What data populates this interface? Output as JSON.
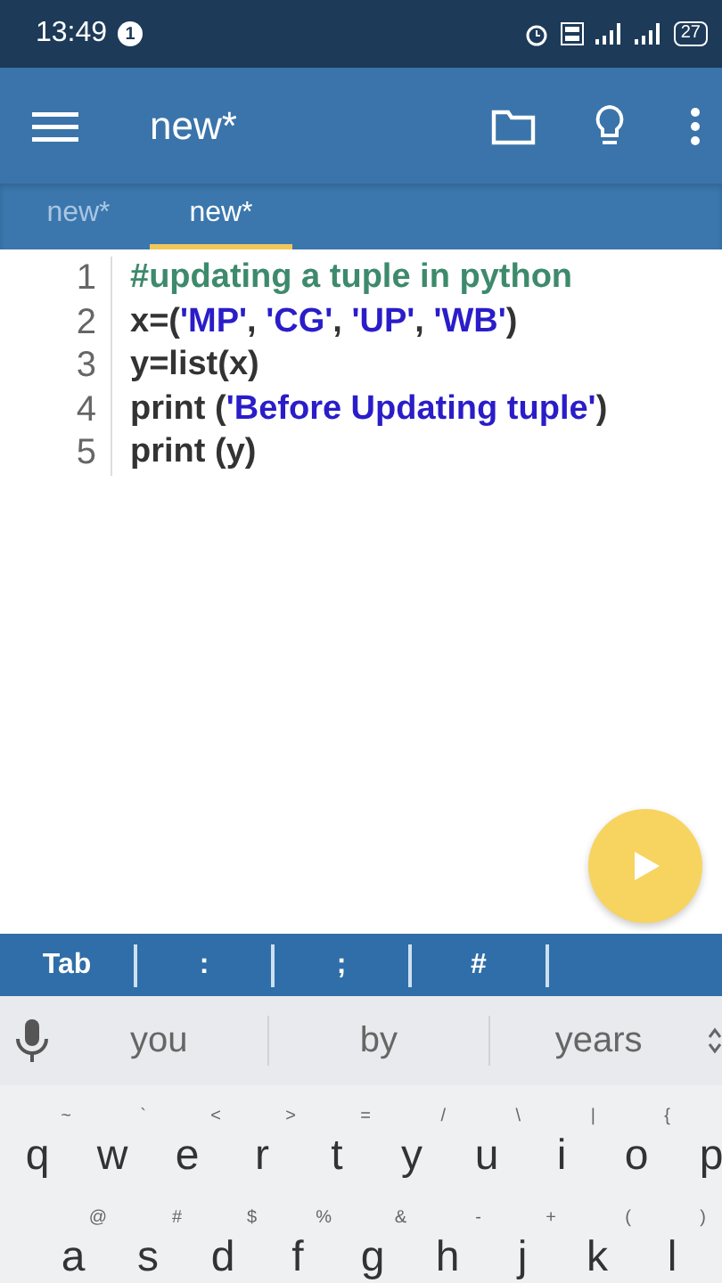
{
  "status_bar": {
    "time": "13:49",
    "notification_count": "1",
    "battery": "27"
  },
  "app_bar": {
    "title": "new*"
  },
  "tabs": [
    {
      "label": "new*",
      "selected": false
    },
    {
      "label": "new*",
      "selected": true
    }
  ],
  "editor": {
    "lines": [
      {
        "number": "1",
        "tokens": [
          {
            "kind": "comment",
            "text": "#updating a tuple in python"
          }
        ]
      },
      {
        "number": "2",
        "tokens": [
          {
            "kind": "code",
            "text": "x=("
          },
          {
            "kind": "string",
            "text": "'MP'"
          },
          {
            "kind": "code",
            "text": ", "
          },
          {
            "kind": "string",
            "text": "'CG'"
          },
          {
            "kind": "code",
            "text": ", "
          },
          {
            "kind": "string",
            "text": "'UP'"
          },
          {
            "kind": "code",
            "text": ", "
          },
          {
            "kind": "string",
            "text": "'WB'"
          },
          {
            "kind": "code",
            "text": ")"
          }
        ]
      },
      {
        "number": "3",
        "tokens": [
          {
            "kind": "code",
            "text": "y=list(x)"
          }
        ]
      },
      {
        "number": "4",
        "tokens": [
          {
            "kind": "code",
            "text": "print ("
          },
          {
            "kind": "string",
            "text": "'Before Updating tuple'"
          },
          {
            "kind": "code",
            "text": ")"
          }
        ]
      },
      {
        "number": "5",
        "tokens": [
          {
            "kind": "code",
            "text": "print (y)"
          }
        ]
      }
    ]
  },
  "symbol_bar": {
    "keys": [
      {
        "label": "Tab"
      },
      {
        "label": ":"
      },
      {
        "label": ";"
      },
      {
        "label": "#"
      }
    ]
  },
  "suggestions": [
    "you",
    "by",
    "years"
  ],
  "keyboard": {
    "rows": [
      [
        {
          "key": "q",
          "hint": "~"
        },
        {
          "key": "w",
          "hint": "`"
        },
        {
          "key": "e",
          "hint": "<"
        },
        {
          "key": "r",
          "hint": ">"
        },
        {
          "key": "t",
          "hint": "="
        },
        {
          "key": "y",
          "hint": "/"
        },
        {
          "key": "u",
          "hint": "\\"
        },
        {
          "key": "i",
          "hint": "|"
        },
        {
          "key": "o",
          "hint": "{"
        },
        {
          "key": "p"
        }
      ],
      [
        {
          "key": "a",
          "hint": "@"
        },
        {
          "key": "s",
          "hint": "#"
        },
        {
          "key": "d",
          "hint": "$"
        },
        {
          "key": "f",
          "hint": "%"
        },
        {
          "key": "g",
          "hint": "&"
        },
        {
          "key": "h",
          "hint": "-"
        },
        {
          "key": "j",
          "hint": "+"
        },
        {
          "key": "k",
          "hint": "("
        },
        {
          "key": "l",
          "hint": ")"
        }
      ]
    ]
  }
}
